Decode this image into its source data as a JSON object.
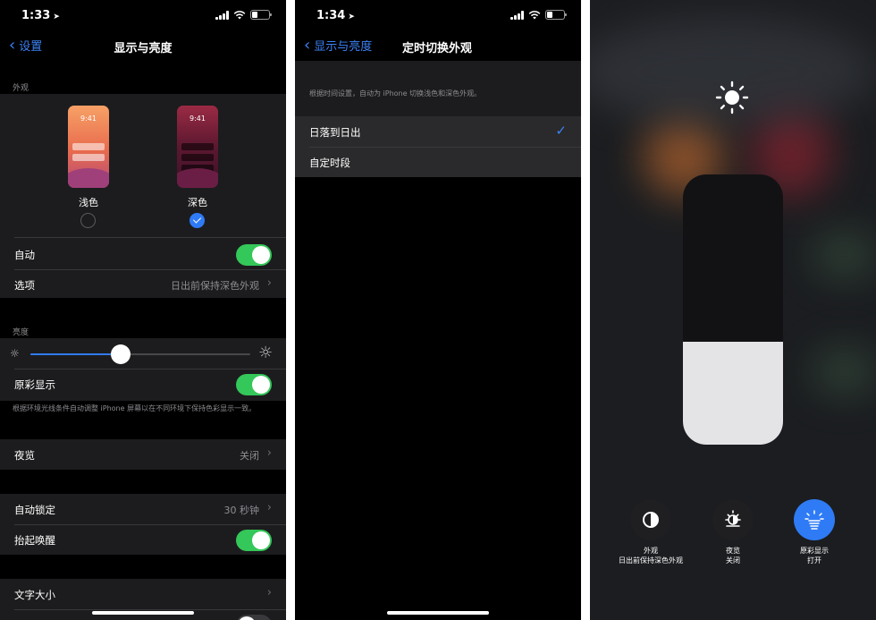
{
  "screen1": {
    "status": {
      "time": "1:33"
    },
    "nav": {
      "back": "设置",
      "title": "显示与亮度"
    },
    "appearance": {
      "section": "外观",
      "light": {
        "time": "9:41",
        "label": "浅色",
        "selected": false
      },
      "dark": {
        "time": "9:41",
        "label": "深色",
        "selected": true
      }
    },
    "auto_row": {
      "label": "自动",
      "on": true
    },
    "options_row": {
      "label": "选项",
      "value": "日出前保持深色外观"
    },
    "brightness": {
      "section": "亮度",
      "level": 0.41
    },
    "true_tone": {
      "label": "原彩显示",
      "on": true,
      "footnote": "根据环境光线条件自动调整 iPhone 屏幕以在不同环境下保持色彩显示一致。"
    },
    "night_shift": {
      "label": "夜览",
      "value": "关闭"
    },
    "auto_lock": {
      "label": "自动锁定",
      "value": "30 秒钟"
    },
    "raise_to_wake": {
      "label": "抬起唤醒",
      "on": true
    },
    "text_size": {
      "label": "文字大小"
    }
  },
  "screen2": {
    "status": {
      "time": "1:34"
    },
    "nav": {
      "back": "显示与亮度",
      "title": "定时切换外观"
    },
    "description": "根据时间设置，自动为 iPhone 切换浅色和深色外观。",
    "options": [
      {
        "label": "日落到日出",
        "selected": true
      },
      {
        "label": "自定时段",
        "selected": false
      }
    ]
  },
  "screen3": {
    "brightness_level": 0.38,
    "buttons": [
      {
        "name": "外观",
        "sub": "日出前保持深色外观",
        "active": false,
        "icon": "appearance-icon"
      },
      {
        "name": "夜览",
        "sub": "关闭",
        "active": false,
        "icon": "night-shift-icon"
      },
      {
        "name": "原彩显示",
        "sub": "打开",
        "active": true,
        "icon": "true-tone-icon"
      }
    ]
  },
  "colors": {
    "accent": "#2f7bf6",
    "toggle_on": "#34c759",
    "group_bg": "#1c1c1e"
  }
}
